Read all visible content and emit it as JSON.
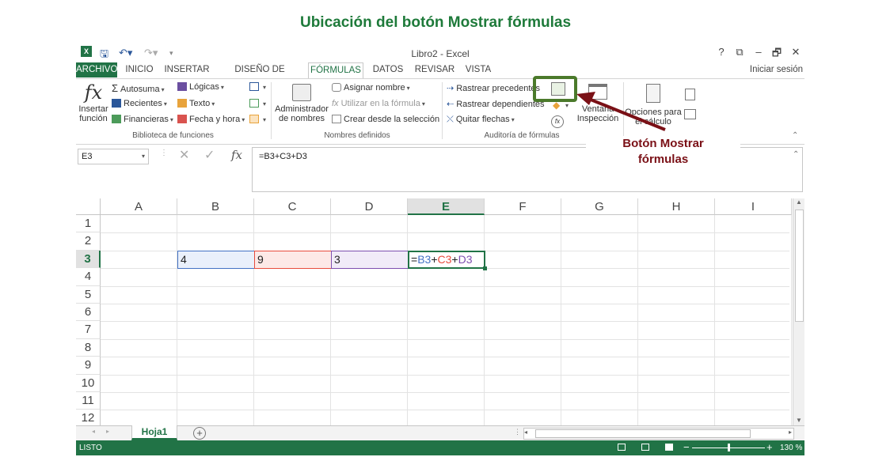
{
  "page_title": "Ubicación del botón Mostrar fórmulas",
  "window": {
    "title": "Libro2 - Excel",
    "help": "?",
    "minimize": "–",
    "restore": "🗗",
    "close": "✕",
    "signin": "Iniciar sesión"
  },
  "tabs": [
    "ARCHIVO",
    "INICIO",
    "INSERTAR",
    "DISEÑO DE PÁGINA",
    "FÓRMULAS",
    "DATOS",
    "REVISAR",
    "VISTA"
  ],
  "ribbon": {
    "insertar_funcion": [
      "Insertar",
      "función"
    ],
    "biblioteca": {
      "autosuma": "Autosuma",
      "recientes": "Recientes",
      "financieras": "Financieras",
      "logicas": "Lógicas",
      "texto": "Texto",
      "fecha_hora": "Fecha y hora",
      "label": "Biblioteca de funciones"
    },
    "nombres": {
      "administrador": [
        "Administrador",
        "de nombres"
      ],
      "asignar": "Asignar nombre",
      "utilizar": "Utilizar en la fórmula",
      "crear": "Crear desde la selección",
      "label": "Nombres definidos"
    },
    "auditoria": {
      "precedentes": "Rastrear precedentes",
      "dependientes": "Rastrear dependientes",
      "quitar": "Quitar flechas",
      "label": "Auditoría de fórmulas"
    },
    "ventana": [
      "Ventana",
      "Inspección"
    ],
    "opciones": [
      "Opciones para",
      "el cálculo"
    ]
  },
  "formula_bar": {
    "name_box": "E3",
    "formula": "=B3+C3+D3",
    "fx": "fx"
  },
  "columns": [
    "A",
    "B",
    "C",
    "D",
    "E",
    "F",
    "G",
    "H",
    "I"
  ],
  "rows": [
    "1",
    "2",
    "3",
    "4",
    "5",
    "6",
    "7",
    "8",
    "9",
    "10",
    "11",
    "12"
  ],
  "cells": {
    "B3": "4",
    "C3": "9",
    "D3": "3",
    "E3_parts": [
      "=",
      "B3",
      "+",
      "C3",
      "+",
      "D3"
    ]
  },
  "sheet_tab": "Hoja1",
  "status": {
    "ready": "LISTO",
    "zoom": "130 %"
  },
  "annotation": [
    "Botón Mostrar",
    "fórmulas"
  ],
  "colors": {
    "excel_green": "#217346",
    "ref_blue": "#4472c4",
    "ref_red": "#e84c3d",
    "ref_purple": "#7e4fb0",
    "arrow": "#7a1016"
  }
}
